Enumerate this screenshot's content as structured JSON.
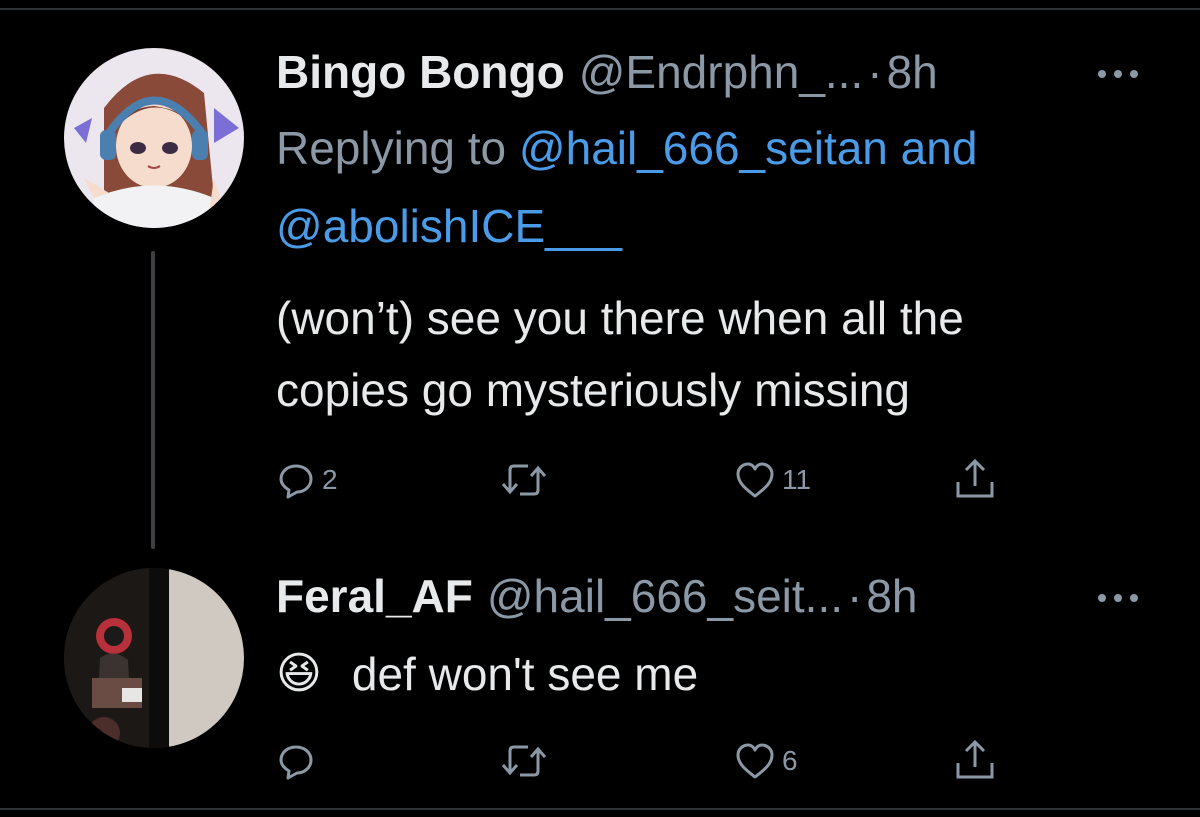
{
  "tweets": [
    {
      "display_name": "Bingo Bongo",
      "handle": "@Endrphn_...",
      "dot": "·",
      "time": "8h",
      "replying_prefix": "Replying to ",
      "replying_mention_1": "@hail_666_seitan",
      "replying_and": " and",
      "replying_mention_2": "@abolishICE___",
      "text_line_1": "(won’t) see you there when all the",
      "text_line_2": "copies go mysteriously missing",
      "reply_count": "2",
      "retweet_count": "",
      "like_count": "11"
    },
    {
      "display_name": "Feral_AF",
      "handle": "@hail_666_seit...",
      "dot": "·",
      "time": "8h",
      "emoji": "😆",
      "text": "def won't see me",
      "reply_count": "",
      "retweet_count": "",
      "like_count": "6"
    }
  ],
  "icons": {
    "reply": "reply-icon",
    "retweet": "retweet-icon",
    "like": "heart-icon",
    "share": "share-icon",
    "more": "more-icon"
  },
  "colors": {
    "background": "#000000",
    "text": "#e7e9ea",
    "muted": "#8b98a5",
    "link": "#4a9ce8",
    "thread_line": "#3e4144"
  }
}
